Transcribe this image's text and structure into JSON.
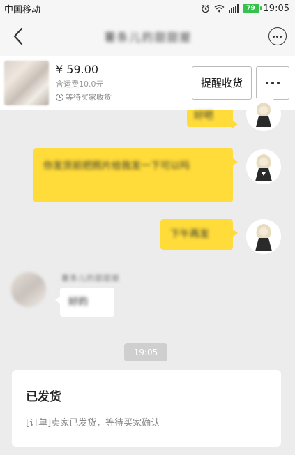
{
  "status_bar": {
    "carrier": "中国移动",
    "battery": "79",
    "time": "19:05"
  },
  "nav": {
    "title": "薯条儿的甜甜屋"
  },
  "product": {
    "price": "¥ 59.00",
    "shipping": "含运费10.0元",
    "status": "等待买家收货",
    "remind_label": "提醒收货"
  },
  "chat": {
    "message_1": "好吧",
    "message_2": "你发货前把照片给我发一下可以吗",
    "message_3": "下午再发",
    "seller_name": "薯条儿的甜甜屋",
    "seller_reply": "好的",
    "time": "19:05"
  },
  "shipped_card": {
    "title": "已发货",
    "desc": "[订单]卖家已发货，等待买家确认"
  },
  "colors": {
    "bubble": "#ffdc3a",
    "background": "#ececec"
  }
}
